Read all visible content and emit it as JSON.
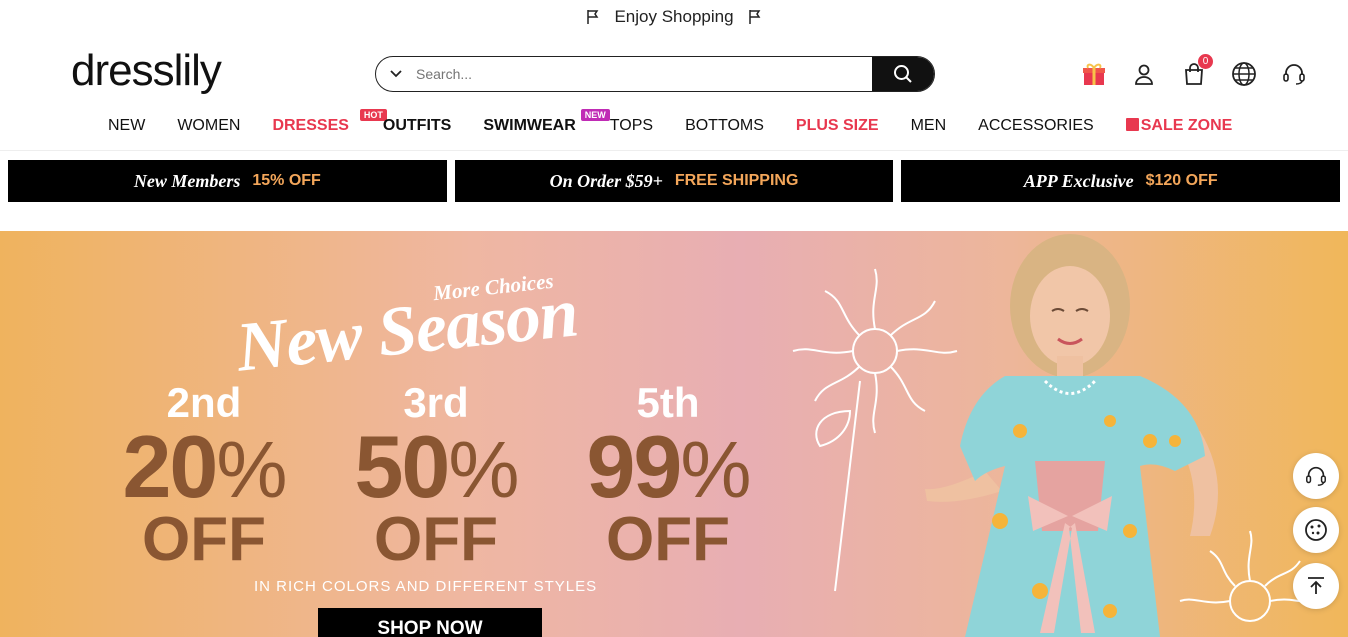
{
  "announcement": {
    "text": "Enjoy Shopping"
  },
  "brand": {
    "logo": "dresslily"
  },
  "search": {
    "placeholder": "Search..."
  },
  "header_icons": {
    "cart_count": "0"
  },
  "nav": {
    "items": [
      {
        "label": "NEW"
      },
      {
        "label": "WOMEN"
      },
      {
        "label": "DRESSES",
        "tag": "HOT"
      },
      {
        "label": "OUTFITS"
      },
      {
        "label": "SWIMWEAR",
        "tag": "NEW"
      },
      {
        "label": "TOPS"
      },
      {
        "label": "BOTTOMS"
      },
      {
        "label": "PLUS SIZE"
      },
      {
        "label": "MEN"
      },
      {
        "label": "ACCESSORIES"
      },
      {
        "label": "SALE ZONE"
      }
    ]
  },
  "promos": [
    {
      "lead": "New Members",
      "accent": "15% OFF"
    },
    {
      "lead": "On Order $59+",
      "accent": "FREE SHIPPING"
    },
    {
      "lead": "APP Exclusive",
      "accent": "$120 OFF"
    }
  ],
  "hero": {
    "script_small": "More Choices",
    "script_main": "New Season",
    "offers": [
      {
        "ordinal": "2nd",
        "percent": "20",
        "off": "OFF"
      },
      {
        "ordinal": "3rd",
        "percent": "50",
        "off": "OFF"
      },
      {
        "ordinal": "5th",
        "percent": "99",
        "off": "OFF"
      }
    ],
    "percent_symbol": "%",
    "subline": "IN RICH COLORS AND DIFFERENT STYLES",
    "cta": "SHOP NOW"
  },
  "colors": {
    "accent_red": "#e8384f",
    "promo_accent": "#f3a65a",
    "offer_brown": "#8a5632"
  },
  "icons": [
    "flag-icon",
    "chevron-down-icon",
    "search-icon",
    "gift-icon",
    "user-icon",
    "cart-icon",
    "globe-icon",
    "headset-icon",
    "cookie-icon",
    "back-to-top-icon"
  ]
}
